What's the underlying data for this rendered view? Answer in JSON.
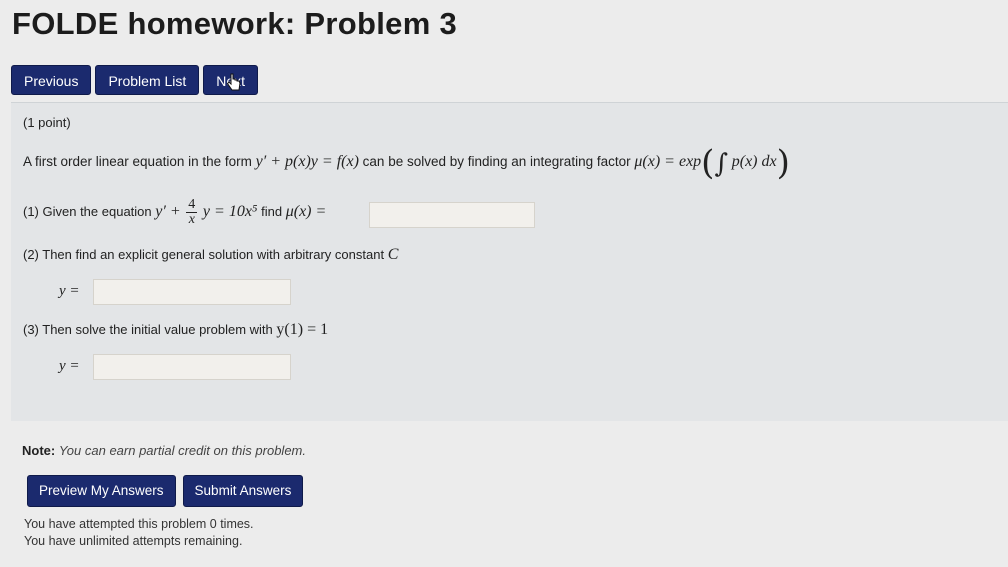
{
  "page_title": "FOLDE homework: Problem 3",
  "nav": {
    "previous": "Previous",
    "problem_list": "Problem List",
    "next": "Next"
  },
  "problem": {
    "points": "(1 point)",
    "intro": "A first order linear equation in the form",
    "intro_eq": "y′ + p(x)y = f(x)",
    "intro_mid": "can be solved by finding an integrating factor",
    "intro_mu": "μ(x) = exp",
    "intro_int": "p(x) dx",
    "q1_prefix": "(1) Given the equation",
    "q1_eq_lhs": "y′ +",
    "q1_frac_num": "4",
    "q1_frac_den": "x",
    "q1_eq_rhs": "y = 10x⁵",
    "q1_find": "find",
    "q1_mu": "μ(x) =",
    "q2_text": "(2) Then find an explicit general solution with arbitrary constant",
    "q2_const": "C",
    "q2_y": "y =",
    "q3_text": "(3) Then solve the initial value problem with",
    "q3_cond": "y(1) = 1",
    "q3_y": "y ="
  },
  "inputs": {
    "mu_value": "",
    "general_value": "",
    "ivp_value": ""
  },
  "note": {
    "label": "Note:",
    "text": "You can earn partial credit on this problem."
  },
  "actions": {
    "preview": "Preview My Answers",
    "submit": "Submit Answers"
  },
  "attempts": {
    "line1": "You have attempted this problem 0 times.",
    "line2": "You have unlimited attempts remaining."
  },
  "colors": {
    "button_bg": "#1b2a6e",
    "panel_bg": "#e3e5e7",
    "page_bg": "#ececec"
  }
}
